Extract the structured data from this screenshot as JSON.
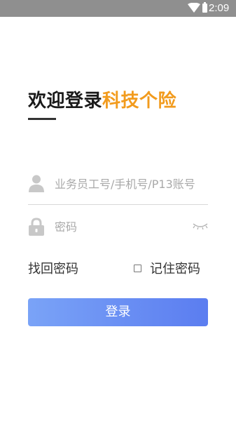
{
  "status_bar": {
    "time": "2:09",
    "icons": [
      "wifi-icon",
      "battery-icon"
    ]
  },
  "header": {
    "title_prefix": "欢迎登录",
    "title_brand": "科技个险",
    "brand_color": "#f29b1d"
  },
  "form": {
    "username": {
      "icon": "user-icon",
      "value": "",
      "placeholder": "业务员工号/手机号/P13账号"
    },
    "password": {
      "icon": "lock-icon",
      "value": "",
      "placeholder": "密码",
      "toggle_icon": "eye-closed-icon"
    },
    "forgot_label": "找回密码",
    "remember_label": "记住密码",
    "remember_checked": false,
    "submit_label": "登录",
    "submit_colors": [
      "#7aa3f7",
      "#5b7df0"
    ]
  }
}
